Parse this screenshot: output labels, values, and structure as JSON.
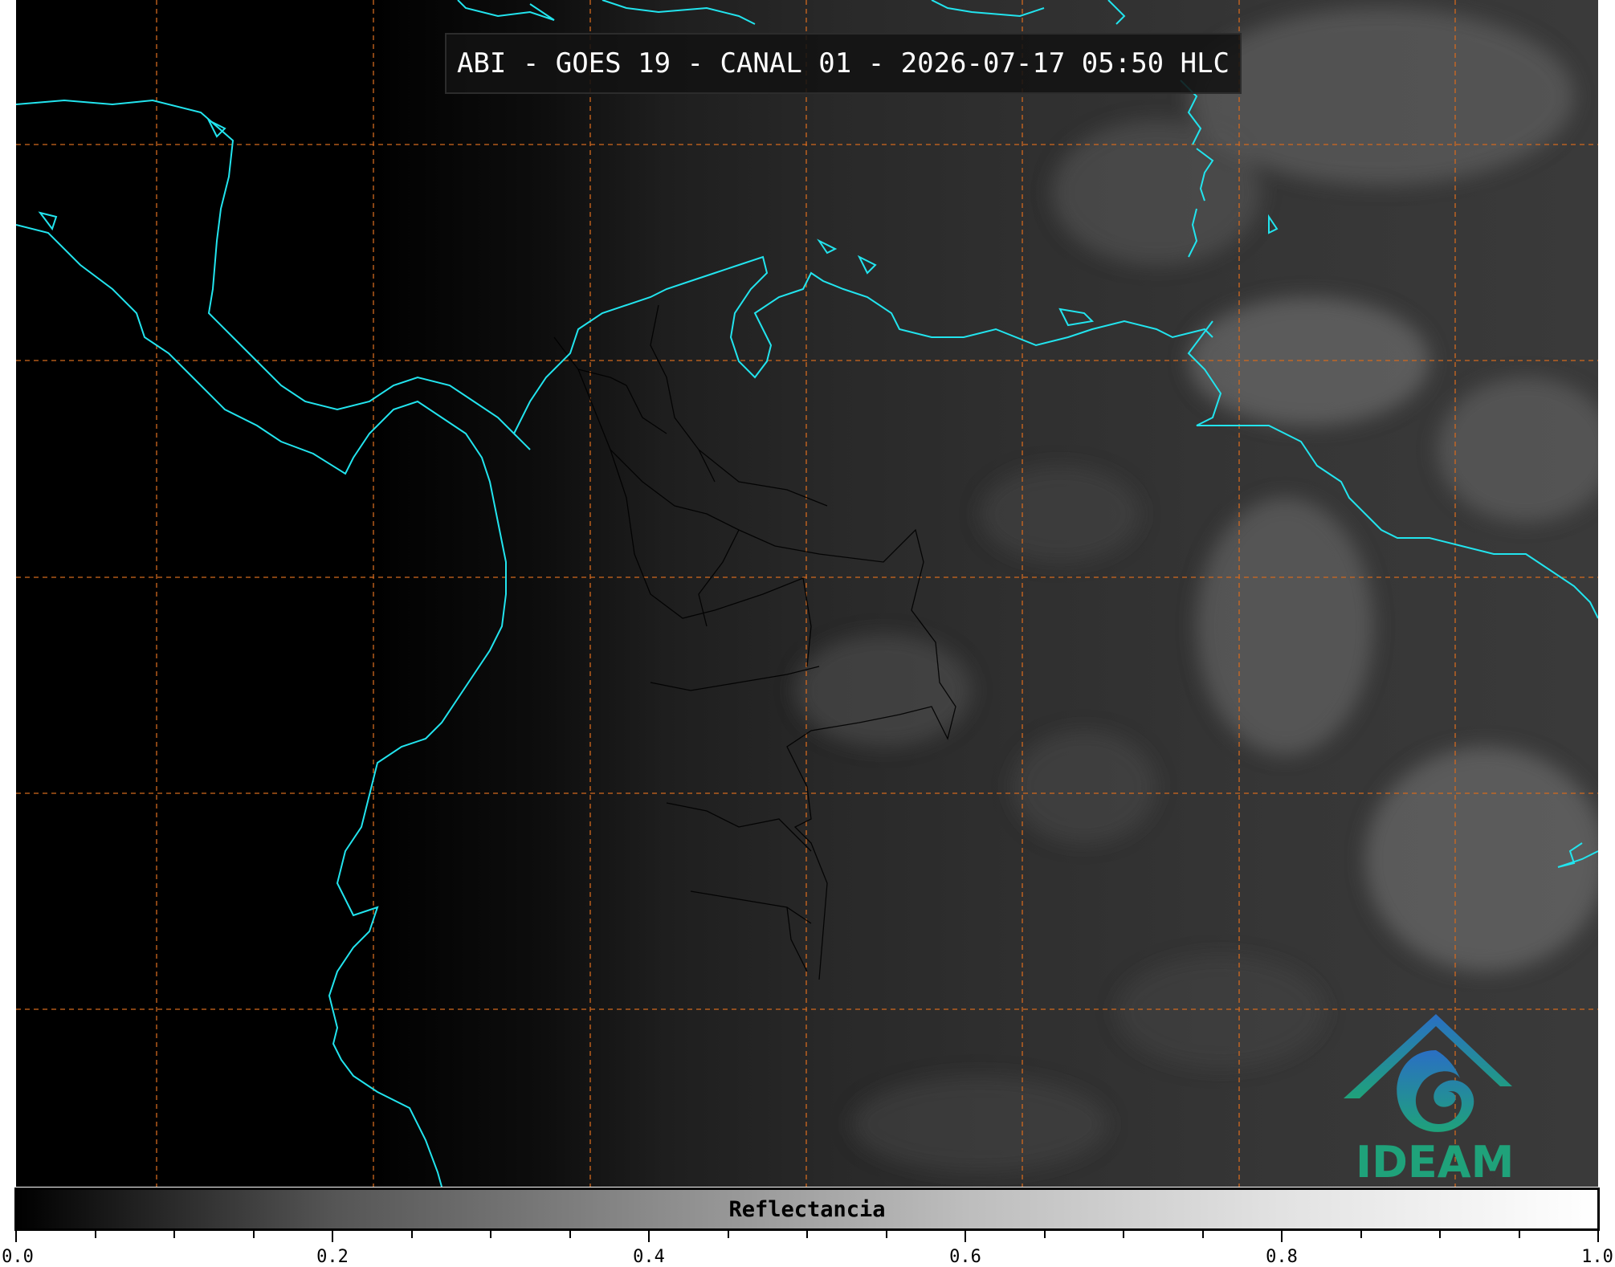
{
  "title": "ABI - GOES 19 - CANAL 01 - 2026-07-17 05:50 HLC",
  "colorbar": {
    "label": "Reflectancia",
    "min": 0.0,
    "max": 1.0,
    "tick_labels": [
      "0.0",
      "0.2",
      "0.4",
      "0.6",
      "0.8",
      "1.0"
    ],
    "tick_values": [
      0.0,
      0.2,
      0.4,
      0.6,
      0.8,
      1.0
    ],
    "minor_tick_step": 0.05
  },
  "logo": {
    "text": "IDEAM",
    "icon": "ideam-logo-icon",
    "color_top": "#2a6fc4",
    "color_bottom": "#1fa27a"
  },
  "map": {
    "coastline_color": "#22e4ee",
    "grid_color": "#d2691e",
    "border_color": "#000000"
  }
}
